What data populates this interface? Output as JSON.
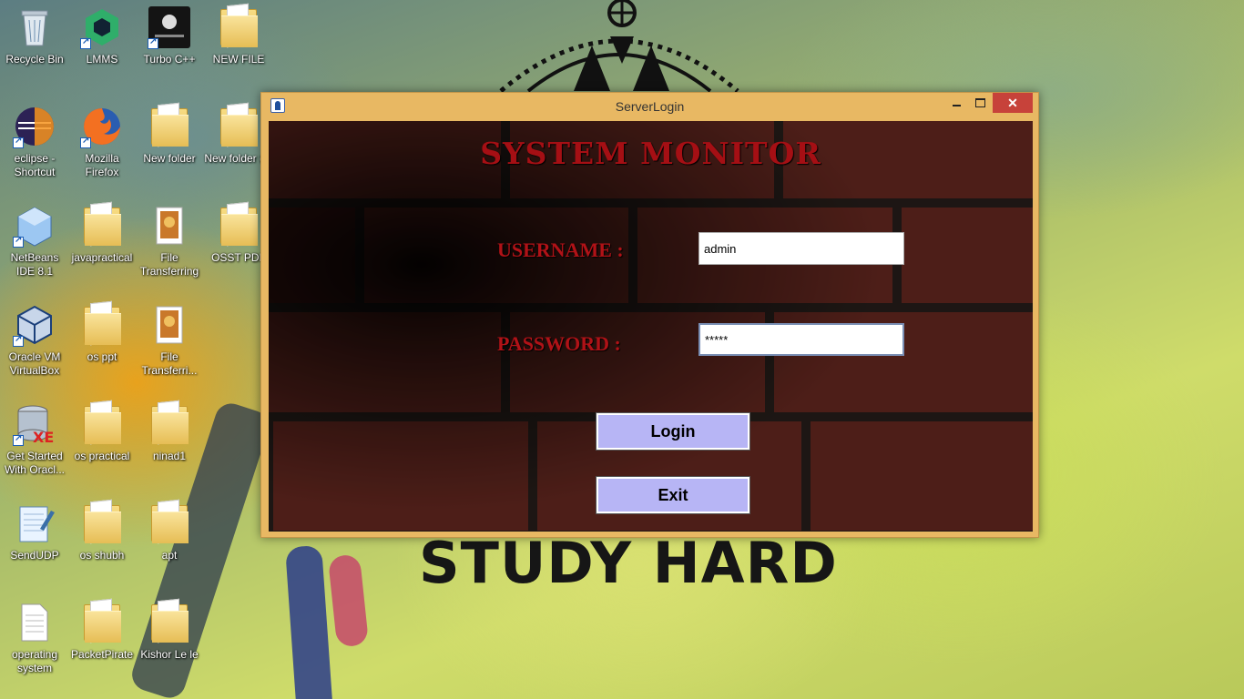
{
  "desktop": {
    "background_text": "STUDY HARD",
    "icons": [
      {
        "label": "Recycle Bin",
        "icon": "recycle-bin-icon"
      },
      {
        "label": "LMMS",
        "icon": "lmms-icon"
      },
      {
        "label": "Turbo C++",
        "icon": "turbo-cpp-icon"
      },
      {
        "label": "NEW FILE",
        "icon": "folder-icon"
      },
      {
        "label": "eclipse - Shortcut",
        "icon": "eclipse-icon"
      },
      {
        "label": "Mozilla Firefox",
        "icon": "firefox-icon"
      },
      {
        "label": "New folder",
        "icon": "folder-icon"
      },
      {
        "label": "New folder (2)",
        "icon": "folder-icon"
      },
      {
        "label": "NetBeans IDE 8.1",
        "icon": "netbeans-icon"
      },
      {
        "label": "javapractical",
        "icon": "folder-icon"
      },
      {
        "label": "File Transferring",
        "icon": "file-icon"
      },
      {
        "label": "OSST PDF",
        "icon": "folder-icon"
      },
      {
        "label": "Oracle VM VirtualBox",
        "icon": "virtualbox-icon"
      },
      {
        "label": "os ppt",
        "icon": "folder-icon"
      },
      {
        "label": "File Transferri...",
        "icon": "file-icon"
      },
      {
        "label": "Get Started With Oracl...",
        "icon": "oracle-xe-icon"
      },
      {
        "label": "os practical",
        "icon": "folder-icon"
      },
      {
        "label": "ninad1",
        "icon": "folder-icon"
      },
      {
        "label": "SendUDP",
        "icon": "notepad-icon"
      },
      {
        "label": "os shubh",
        "icon": "folder-icon"
      },
      {
        "label": "apt",
        "icon": "folder-icon"
      },
      {
        "label": "operating system",
        "icon": "text-file-icon"
      },
      {
        "label": "PacketPirate",
        "icon": "folder-icon"
      },
      {
        "label": "Kishor Le le",
        "icon": "folder-icon"
      }
    ]
  },
  "window": {
    "title": "ServerLogin",
    "close_glyph": "✕",
    "heading": "SYSTEM MONITOR",
    "username_label": "USERNAME :",
    "password_label": "PASSWORD :",
    "username_value": "admin",
    "password_value": "*****",
    "login_label": "Login",
    "exit_label": "Exit"
  },
  "colors": {
    "title_bar": "#e8b863",
    "heading_red": "#a50f14",
    "button_fill": "#b7b5f5",
    "close_button": "#c7423a"
  }
}
